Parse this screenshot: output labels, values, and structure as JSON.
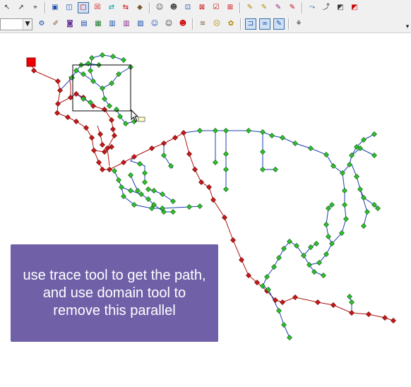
{
  "toolbar_top": {
    "buttons": [
      {
        "name": "pointer-tool-icon",
        "glyph": "↖",
        "color": "#333333"
      },
      {
        "name": "select-arrow-icon",
        "glyph": "➚",
        "color": "#333333"
      },
      {
        "name": "edit-vertex-icon",
        "glyph": "⌖",
        "color": "#333333"
      },
      {
        "name": "add-node-icon",
        "glyph": "▣",
        "color": "#1a4fb0"
      },
      {
        "name": "add-link-icon",
        "glyph": "◫",
        "color": "#1a4fb0"
      },
      {
        "name": "rectangle-select-icon",
        "glyph": "▢",
        "color": "#cc0000",
        "active": true
      },
      {
        "name": "delete-box-icon",
        "glyph": "☒",
        "color": "#cc0000"
      },
      {
        "name": "move-icon",
        "glyph": "⇄",
        "color": "#009c9c"
      },
      {
        "name": "split-icon",
        "glyph": "⇆",
        "color": "#cc0000"
      },
      {
        "name": "erase-icon",
        "glyph": "◆",
        "color": "#7a5a30"
      },
      {
        "name": "user-node-icon",
        "glyph": "☺",
        "color": "#444444"
      },
      {
        "name": "user-link-icon",
        "glyph": "☻",
        "color": "#444444"
      },
      {
        "name": "connect-icon",
        "glyph": "⊡",
        "color": "#1a4fb0"
      },
      {
        "name": "disconnect-icon",
        "glyph": "⊠",
        "color": "#cc0000"
      },
      {
        "name": "check-icon",
        "glyph": "☑",
        "color": "#cc0000"
      },
      {
        "name": "branch-icon",
        "glyph": "⊞",
        "color": "#cc0000"
      },
      {
        "name": "edit-note-icon",
        "glyph": "✎",
        "color": "#b08a00"
      },
      {
        "name": "edit-note-2-icon",
        "glyph": "✎",
        "color": "#b08a00"
      },
      {
        "name": "edit-purple-icon",
        "glyph": "✎",
        "color": "#8a2a8a"
      },
      {
        "name": "edit-red-icon",
        "glyph": "✎",
        "color": "#cc0000"
      },
      {
        "name": "pipe-icon",
        "glyph": "⤳",
        "color": "#1a4fb0"
      },
      {
        "name": "pipe-curve-icon",
        "glyph": "⤴",
        "color": "#333333"
      },
      {
        "name": "resize-icon",
        "glyph": "◩",
        "color": "#333333"
      },
      {
        "name": "resize-red-icon",
        "glyph": "◩",
        "color": "#cc0000"
      }
    ]
  },
  "toolbar_bottom": {
    "buttons": [
      {
        "name": "network-icon",
        "glyph": "⚙",
        "color": "#1a4fb0"
      },
      {
        "name": "pencil-ruler-icon",
        "glyph": "✐",
        "color": "#7a5a30"
      },
      {
        "name": "barrel-icon",
        "glyph": "◙",
        "color": "#6a3a9a"
      },
      {
        "name": "report-icon",
        "glyph": "▤",
        "color": "#1a4fb0"
      },
      {
        "name": "table-icon",
        "glyph": "▦",
        "color": "#1a7a30"
      },
      {
        "name": "profile-chart-icon",
        "glyph": "▥",
        "color": "#1a4fb0"
      },
      {
        "name": "profile-chart-2-icon",
        "glyph": "▥",
        "color": "#8a2a8a"
      },
      {
        "name": "calculator-icon",
        "glyph": "▨",
        "color": "#1a4fb0"
      },
      {
        "name": "person-icon",
        "glyph": "☺",
        "color": "#1a4fb0"
      },
      {
        "name": "person-doc-icon",
        "glyph": "☺",
        "color": "#333333"
      },
      {
        "name": "person-flag-icon",
        "glyph": "☻",
        "color": "#cc0000"
      },
      {
        "name": "layers-icon",
        "glyph": "≋",
        "color": "#7a5a30"
      },
      {
        "name": "face-icon",
        "glyph": "☹",
        "color": "#b08a00"
      },
      {
        "name": "gear-face-icon",
        "glyph": "✿",
        "color": "#b08a00"
      },
      {
        "name": "trace-tool-icon",
        "glyph": "⊐",
        "color": "#1a4fb0",
        "active": true
      },
      {
        "name": "domain-tool-icon",
        "glyph": "∞",
        "color": "#1a4fb0",
        "active": true
      },
      {
        "name": "edit-domain-icon",
        "glyph": "✎",
        "color": "#1a4fb0",
        "active": true
      },
      {
        "name": "walker-icon",
        "glyph": "⚘",
        "color": "#333333"
      }
    ]
  },
  "callout": {
    "text": "use trace tool to get the path, and use domain tool to remove this parallel"
  },
  "colors": {
    "path_link": "#b01010",
    "path_node": "#c81818",
    "branch_link": "#1a3fb0",
    "branch_node": "#2fc02f",
    "source_node": "#ee0000",
    "callout_bg": "#7060a8"
  }
}
